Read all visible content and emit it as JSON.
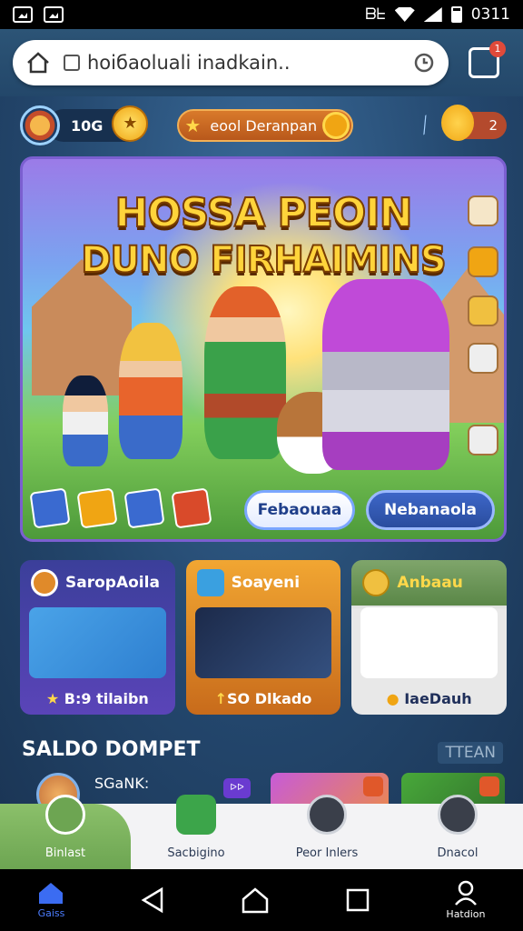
{
  "status_bar": {
    "time": "0311",
    "carrier": "ᗷᖶ"
  },
  "browser": {
    "url": "hoiбaoluali inadkain..",
    "notification_count": "1"
  },
  "header": {
    "coin_value": "10G",
    "event_label": "eool Deranpan",
    "mascot_count": "2"
  },
  "banner": {
    "title_line1": "HOSSA PEOIN",
    "title_line2": "DUNO FIRHAIMINS",
    "button_primary": "Febaouaa",
    "button_secondary": "Nebanaola"
  },
  "cards": [
    {
      "title": "SaropAoila",
      "footer": "B:9 tilaibn",
      "footer_icon": "star-icon"
    },
    {
      "title": "Soayeni",
      "footer": "SO Dlkado",
      "footer_icon": "arrow-up-icon"
    },
    {
      "title": "Anbaau",
      "footer": "IaeDauh",
      "footer_icon": "coin-icon"
    }
  ],
  "wallet": {
    "section_title": "SALDO DOMPET",
    "team_tag": "TTEAN",
    "item_name": "SGaNK:",
    "badge": "ᐅᐅ"
  },
  "app_nav": [
    {
      "label": "Binlast",
      "icon": "home-icon"
    },
    {
      "label": "Sacbigino",
      "icon": "shop-icon"
    },
    {
      "label": "Peor Inlers",
      "icon": "door-icon"
    },
    {
      "label": "Dnacol",
      "icon": "gamepad-icon"
    }
  ],
  "system_nav": {
    "home_label": "Gaiss",
    "profile_label": "Hatdion"
  },
  "colors": {
    "primary": "#23466c",
    "accent": "#f0a513",
    "nav_active": "#6da552"
  }
}
